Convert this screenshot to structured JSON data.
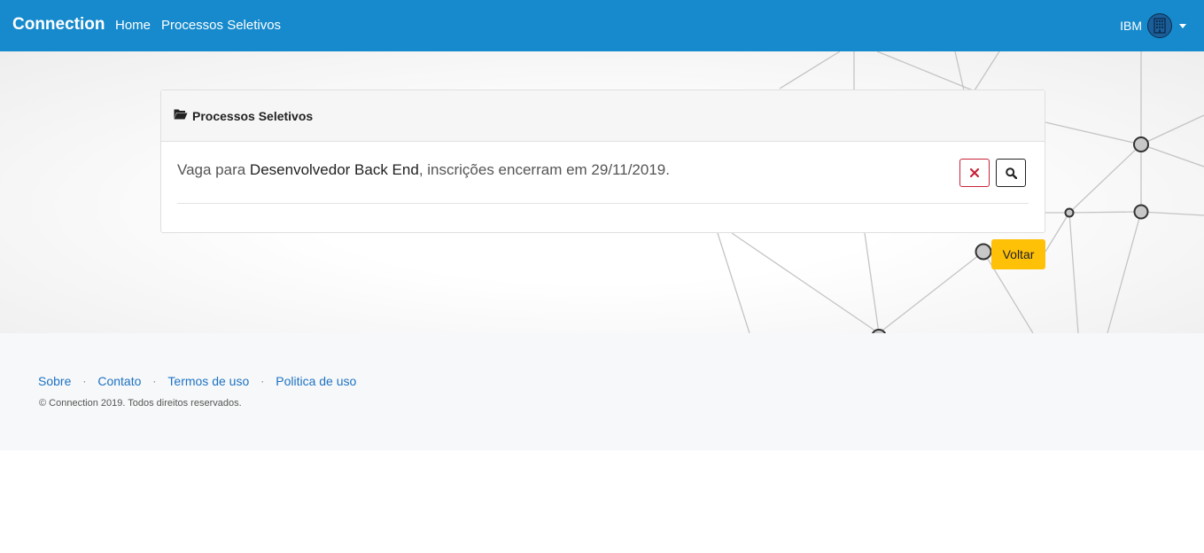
{
  "navbar": {
    "brand": "Connection",
    "links": [
      "Home",
      "Processos Seletivos"
    ],
    "user_name": "IBM",
    "avatar_icon": "building-icon",
    "bg_color": "#168acc"
  },
  "card": {
    "title": "Processos Seletivos",
    "title_icon": "folder-open-icon",
    "job": {
      "prefix": "Vaga para ",
      "role": "Desenvolvedor Back End",
      "suffix": ", inscrições encerram em 29/11/2019."
    },
    "actions": {
      "remove_icon": "close-icon",
      "search_icon": "search-icon"
    }
  },
  "back_button": {
    "label": "Voltar",
    "color": "#ffc107"
  },
  "footer": {
    "links": [
      "Sobre",
      "Contato",
      "Termos de uso",
      "Politica de uso"
    ],
    "separator": "·",
    "copyright": "© Connection 2019. Todos direitos reservados."
  }
}
